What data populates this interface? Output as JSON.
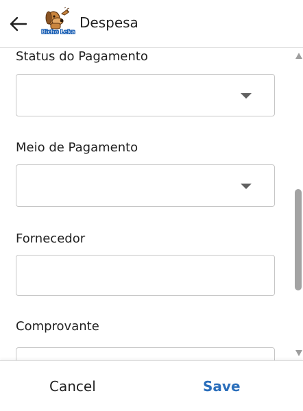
{
  "header": {
    "title": "Despesa",
    "back_icon": "arrow-left-icon",
    "logo_text": "Bicho Leka",
    "logo_colors": {
      "primary": "#1a5fb4",
      "dog": "#c9853e"
    }
  },
  "form": {
    "fields": [
      {
        "label": "Status do Pagamento",
        "type": "select",
        "value": ""
      },
      {
        "label": "Meio de Pagamento",
        "type": "select",
        "value": ""
      },
      {
        "label": "Fornecedor",
        "type": "text",
        "value": ""
      },
      {
        "label": "Comprovante",
        "type": "file",
        "value": ""
      }
    ]
  },
  "footer": {
    "cancel_label": "Cancel",
    "save_label": "Save",
    "save_color": "#2a6ebb"
  }
}
